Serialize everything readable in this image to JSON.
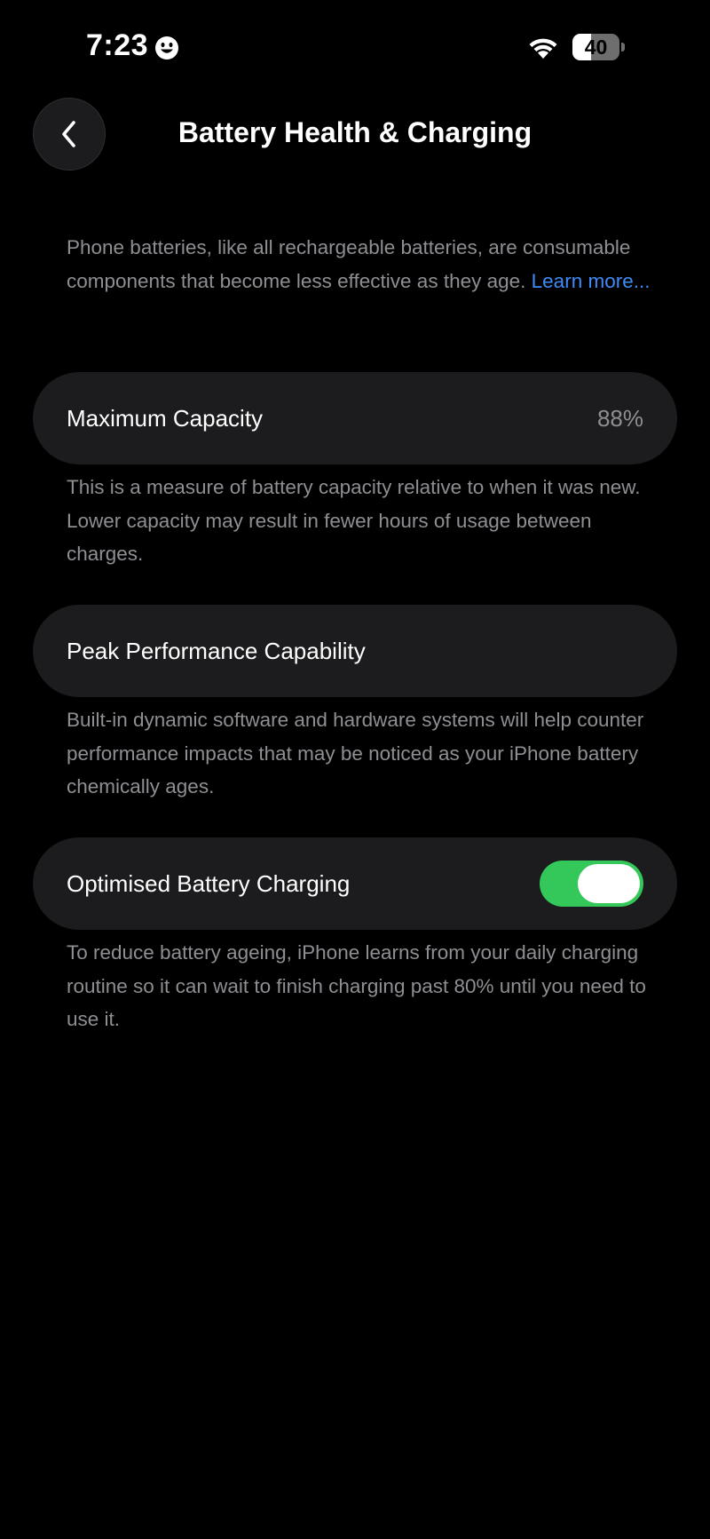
{
  "status_bar": {
    "time": "7:23",
    "focus_icon": "smiley-focus-icon",
    "wifi_icon": "wifi-icon",
    "battery_level": "40",
    "battery_fraction": 0.4
  },
  "nav": {
    "back_icon": "chevron-left-icon",
    "title": "Battery Health & Charging"
  },
  "intro": {
    "text": "Phone batteries, like all rechargeable batteries, are consumable components that become less effective as they age.",
    "link": "Learn more..."
  },
  "max_capacity": {
    "label": "Maximum Capacity",
    "value": "88%",
    "description": "This is a measure of battery capacity relative to when it was new. Lower capacity may result in fewer hours of usage between charges."
  },
  "peak_performance": {
    "label": "Peak Performance Capability",
    "description": "Built-in dynamic software and hardware systems will help counter performance impacts that may be noticed as your iPhone battery chemically ages."
  },
  "optimised_charging": {
    "label": "Optimised Battery Charging",
    "enabled": true,
    "description": "To reduce battery ageing, iPhone learns from your daily charging routine so it can wait to finish charging past 80% until you need to use it."
  },
  "colors": {
    "background": "#000000",
    "card": "#1c1c1e",
    "secondary_text": "#8e8e93",
    "link": "#3e8bf7",
    "toggle_on": "#34c759"
  }
}
